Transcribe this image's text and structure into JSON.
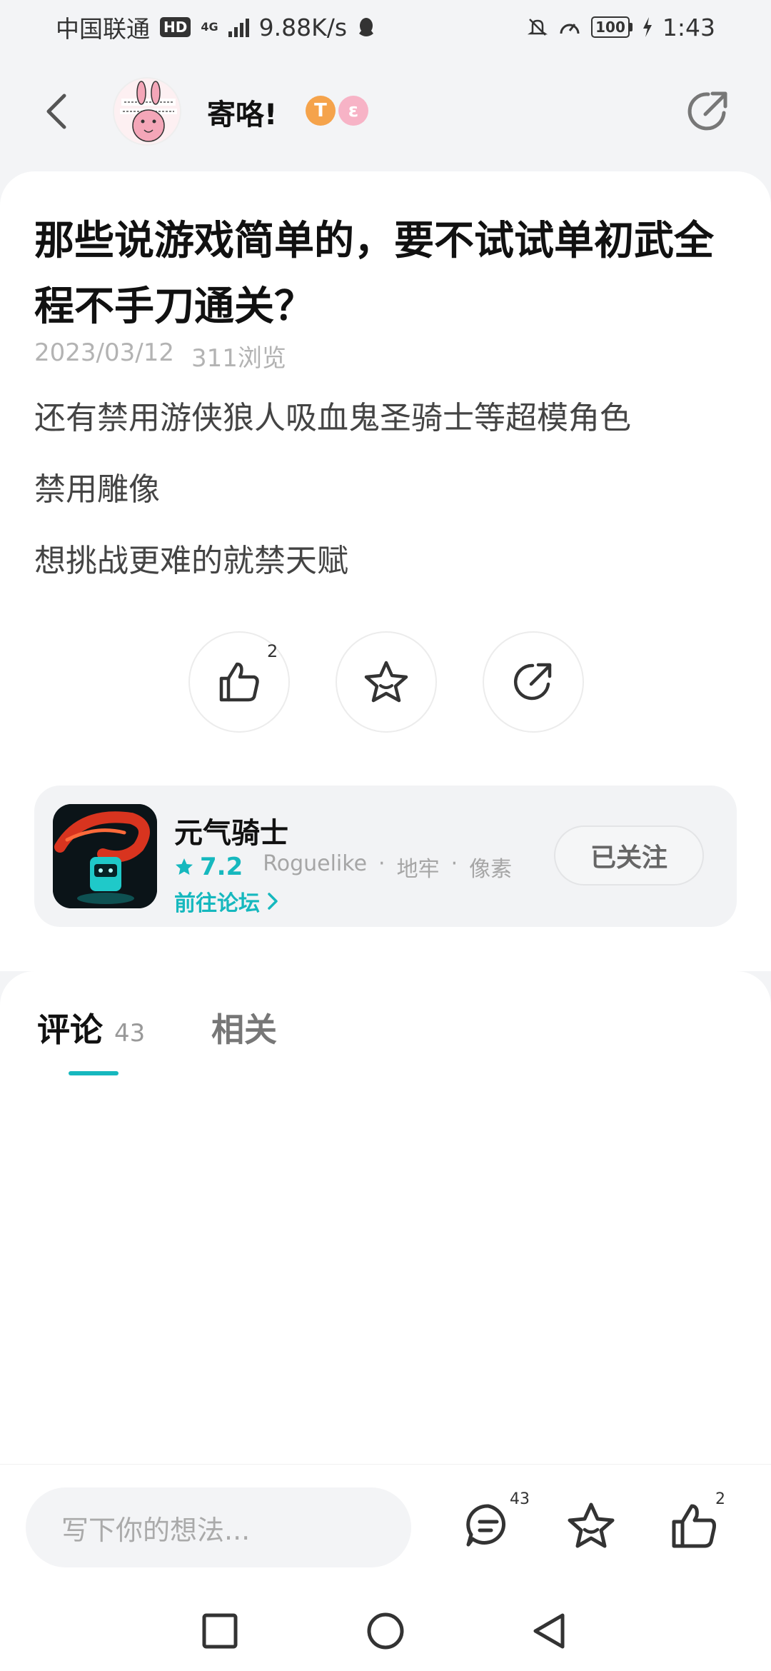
{
  "status_bar": {
    "carrier": "中国联通",
    "hd": "HD",
    "network": "4G",
    "speed": "9.88K/s",
    "battery": "100",
    "time": "1:43"
  },
  "header": {
    "author_name": "寄咯!",
    "badge_t": "T",
    "badge_e": "ε"
  },
  "post": {
    "title": "那些说游戏简单的，要不试试单初武全程不手刀通关？",
    "date": "2023/03/12",
    "views": "311浏览",
    "paragraphs": [
      "还有禁用游侠狼人吸血鬼圣骑士等超模角色",
      "禁用雕像",
      "想挑战更难的就禁天赋"
    ],
    "like_count": "2"
  },
  "game": {
    "name": "元气骑士",
    "rating": "7.2",
    "tags": [
      "Roguelike",
      "·",
      "地牢",
      "·",
      "像素"
    ],
    "forum_link": "前往论坛",
    "follow_label": "已关注"
  },
  "tabs": {
    "comments_label": "评论",
    "comments_count": "43",
    "related_label": "相关"
  },
  "bottom_bar": {
    "input_placeholder": "写下你的想法...",
    "comment_count": "43",
    "like_count": "2"
  },
  "colors": {
    "accent": "#16b8be",
    "text_primary": "#111111",
    "text_secondary": "#444444",
    "meta": "#b3b3b3"
  }
}
